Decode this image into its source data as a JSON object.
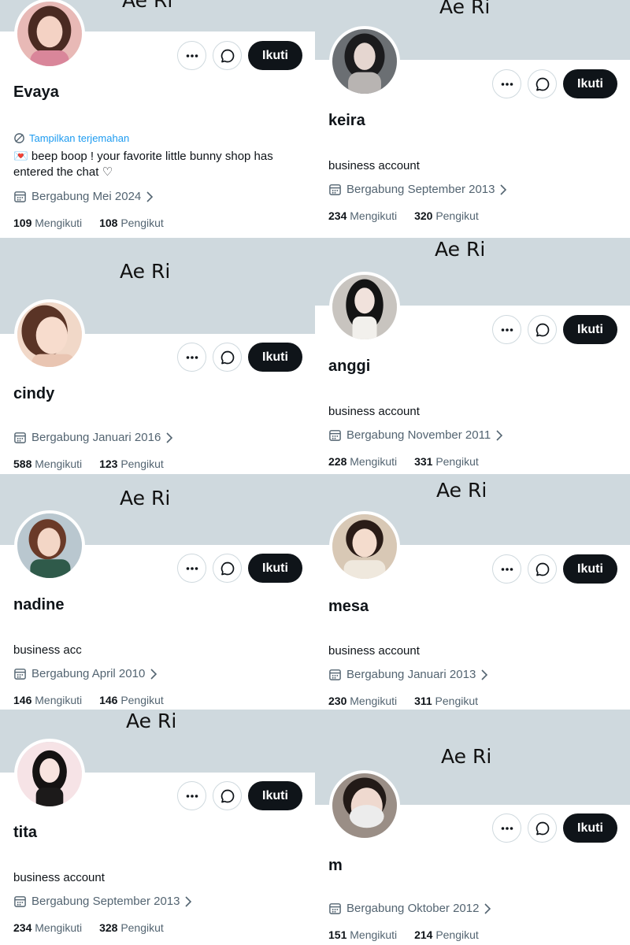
{
  "profiles": [
    {
      "banner_text": "Ae Ri",
      "name": "Evaya",
      "translate_label": "Tampilkan terjemahan",
      "bio_emoji": "💌",
      "bio": "beep boop ! your favorite little bunny shop has entered the chat ♡",
      "joined": "Bergabung Mei 2024",
      "following_count": "109",
      "following_label": "Mengikuti",
      "followers_count": "108",
      "followers_label": "Pengikut",
      "follow_label": "Ikuti",
      "avatar": {
        "bg": "#e8b9b6",
        "hair": "#4a2a22",
        "skin": "#f4d2c4",
        "cloth": "#d9869a"
      }
    },
    {
      "banner_text": "Ae Ri",
      "name": "keira",
      "bio": "business account",
      "joined": "Bergabung September 2013",
      "following_count": "234",
      "following_label": "Mengikuti",
      "followers_count": "320",
      "followers_label": "Pengikut",
      "follow_label": "Ikuti",
      "avatar": {
        "bg": "#6b6f73",
        "hair": "#1b1b1d",
        "skin": "#e5d6d0",
        "cloth": "#b8b4b2"
      }
    },
    {
      "banner_text": "Ae Ri",
      "name": "cindy",
      "joined": "Bergabung Januari 2016",
      "following_count": "588",
      "following_label": "Mengikuti",
      "followers_count": "123",
      "followers_label": "Pengikut",
      "follow_label": "Ikuti",
      "avatar": {
        "bg": "#f1d8c8",
        "hair": "#5a3426",
        "skin": "#f7dccd",
        "cloth": "#e9c5b2"
      }
    },
    {
      "banner_text": "Ae Ri",
      "name": "anggi",
      "bio": "business account",
      "joined": "Bergabung November 2011",
      "following_count": "228",
      "following_label": "Mengikuti",
      "followers_count": "331",
      "followers_label": "Pengikut",
      "follow_label": "Ikuti",
      "avatar": {
        "bg": "#c8c4bf",
        "hair": "#141414",
        "skin": "#f1e2dc",
        "cloth": "#f2f0ec"
      }
    },
    {
      "banner_text": "Ae Ri",
      "name": "nadine",
      "bio": "business acc",
      "joined": "Bergabung April 2010",
      "following_count": "146",
      "following_label": "Mengikuti",
      "followers_count": "146",
      "followers_label": "Pengikut",
      "follow_label": "Ikuti",
      "avatar": {
        "bg": "#b9c7cf",
        "hair": "#6a3a28",
        "skin": "#f3d6c6",
        "cloth": "#2f5a4a"
      }
    },
    {
      "banner_text": "Ae Ri",
      "name": "mesa",
      "bio": "business account",
      "joined": "Bergabung Januari 2013",
      "following_count": "230",
      "following_label": "Mengikuti",
      "followers_count": "311",
      "followers_label": "Pengikut",
      "follow_label": "Ikuti",
      "avatar": {
        "bg": "#d8c8b5",
        "hair": "#2a1c17",
        "skin": "#f4dccd",
        "cloth": "#efe8dd"
      }
    },
    {
      "banner_text": "Ae Ri",
      "name": "tita",
      "bio": "business account",
      "joined": "Bergabung September 2013",
      "following_count": "234",
      "following_label": "Mengikuti",
      "followers_count": "328",
      "followers_label": "Pengikut",
      "follow_label": "Ikuti",
      "avatar": {
        "bg": "#f6e3e6",
        "hair": "#151212",
        "skin": "#f8e4df",
        "cloth": "#1c1a1a"
      }
    },
    {
      "banner_text": "Ae Ri",
      "name": "m",
      "joined": "Bergabung Oktober 2012",
      "following_count": "151",
      "following_label": "Mengikuti",
      "followers_count": "214",
      "followers_label": "Pengikut",
      "follow_label": "Ikuti",
      "avatar": {
        "bg": "#9a8e86",
        "hair": "#221a17",
        "skin": "#efd9cf",
        "cloth": "#ececec"
      }
    }
  ]
}
